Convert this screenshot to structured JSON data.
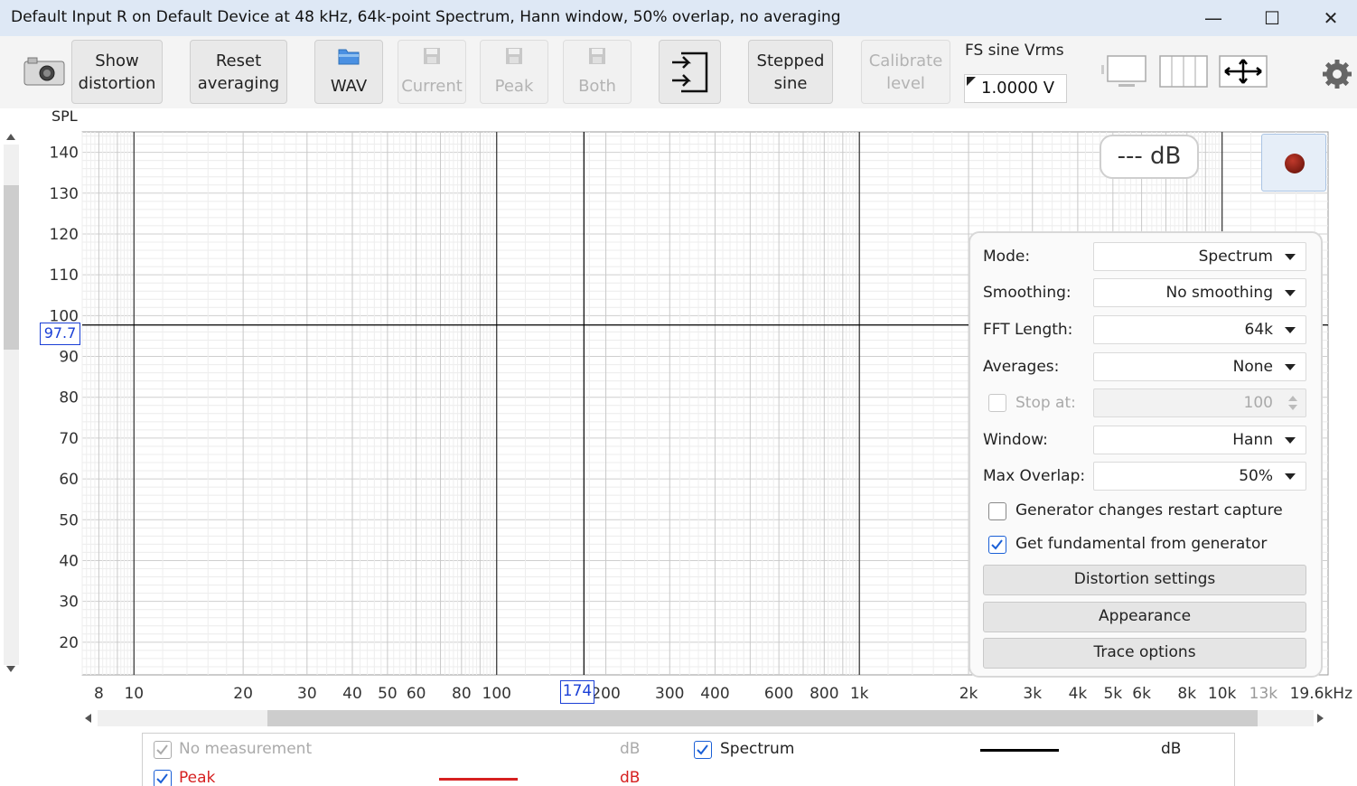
{
  "window": {
    "title": "Default Input R on Default Device at 48 kHz, 64k-point Spectrum, Hann window, 50% overlap, no averaging",
    "minimize": "—",
    "maximize": "☐",
    "close": "✕"
  },
  "toolbar": {
    "camera_icon": "camera-icon",
    "show_distortion_1": "Show",
    "show_distortion_2": "distortion",
    "reset_averaging_1": "Reset",
    "reset_averaging_2": "averaging",
    "wav": "WAV",
    "current": "Current",
    "peak": "Peak",
    "both": "Both",
    "stepped_sine_1": "Stepped",
    "stepped_sine_2": "sine",
    "calibrate_level_1": "Calibrate",
    "calibrate_level_2": "level",
    "fs_label": "FS sine Vrms",
    "fs_value": "1.0000 V"
  },
  "graph": {
    "y_axis_title": "SPL",
    "y_ticks": [
      "140",
      "130",
      "120",
      "110",
      "100",
      "90",
      "80",
      "70",
      "60",
      "50",
      "40",
      "30",
      "20"
    ],
    "x_ticks": [
      "8",
      "10",
      "20",
      "30",
      "40",
      "50",
      "60",
      "80",
      "100",
      "200",
      "300",
      "400",
      "600",
      "800",
      "1k",
      "2k",
      "3k",
      "4k",
      "5k",
      "6k",
      "8k",
      "10k",
      "13k",
      "19.6kHz"
    ],
    "cursor_x": "174",
    "cursor_y": "97.7",
    "db_readout": "--- dB"
  },
  "panel": {
    "mode_label": "Mode:",
    "mode_value": "Spectrum",
    "smoothing_label": "Smoothing:",
    "smoothing_value": "No smoothing",
    "fft_label": "FFT Length:",
    "fft_value": "64k",
    "averages_label": "Averages:",
    "averages_value": "None",
    "stop_at_label": "Stop at:",
    "stop_at_value": "100",
    "window_label": "Window:",
    "window_value": "Hann",
    "overlap_label": "Max Overlap:",
    "overlap_value": "50%",
    "gen_restart_label": "Generator changes restart capture",
    "gen_restart_checked": false,
    "get_fund_label": "Get fundamental from generator",
    "get_fund_checked": true,
    "distortion_settings": "Distortion settings",
    "appearance": "Appearance",
    "trace_options": "Trace options"
  },
  "legend": {
    "no_measurement": "No measurement",
    "no_measurement_unit": "dB",
    "spectrum": "Spectrum",
    "spectrum_unit": "dB",
    "peak": "Peak",
    "peak_unit": "dB",
    "colors": {
      "spectrum": "#000000",
      "peak": "#d62020"
    }
  }
}
